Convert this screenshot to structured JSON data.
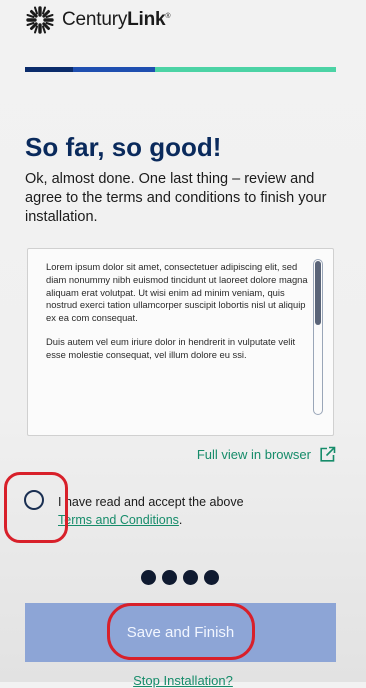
{
  "header": {
    "brand_light": "Century",
    "brand_bold": "Link",
    "trademark": "®",
    "logo_icon": "centurylink-starburst-icon"
  },
  "progress": {
    "steps": 4,
    "completed_fraction": 0.42,
    "colors": {
      "done": "#0b2c6b",
      "current": "#1f4fb0",
      "todo": "#4cd3a5"
    }
  },
  "main": {
    "title": "So far, so good!",
    "intro": "Ok, almost done. One last thing – review and agree to the terms and conditions to finish your installation."
  },
  "terms_box": {
    "paragraphs": [
      "Lorem ipsum dolor sit amet, consectetuer adipiscing elit, sed diam nonummy nibh euismod tincidunt ut laoreet dolore magna aliquam erat volutpat. Ut wisi enim ad minim veniam, quis nostrud exerci tation ullamcorper suscipit lobortis nisl ut aliquip ex ea com consequat.",
      "Duis autem vel eum iriure dolor in hendrerit in vulputate velit esse molestie consequat, vel illum dolore eu ssi."
    ]
  },
  "full_view": {
    "label": "Full view in browser",
    "icon": "external-link-icon"
  },
  "accept": {
    "text": "I have read and accept the above",
    "link": "Terms and Conditions",
    "suffix": ".",
    "checked": false
  },
  "pagination": {
    "dots": 4
  },
  "actions": {
    "save_label": "Save and Finish",
    "stop_label": "Stop Installation?"
  },
  "colors": {
    "title": "#0a2a5c",
    "link": "#168c6a",
    "button": "#8da5d6",
    "highlight": "#d8202a"
  }
}
